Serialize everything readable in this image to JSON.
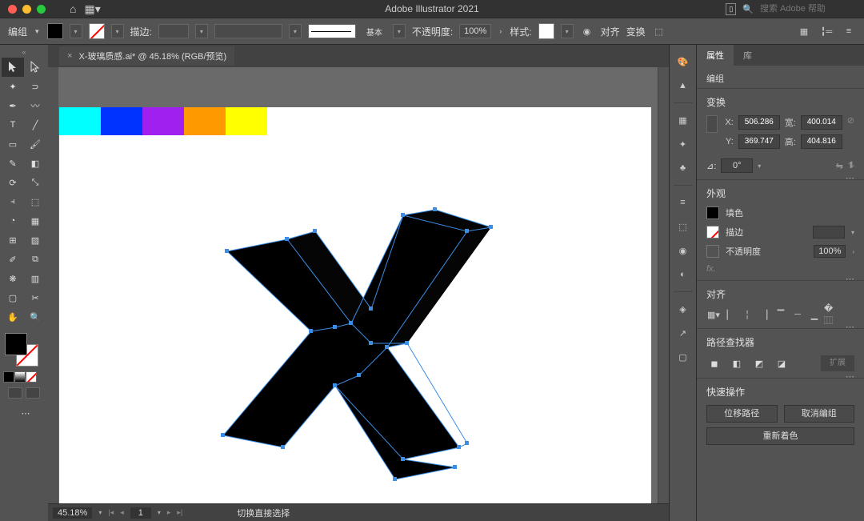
{
  "app": {
    "title": "Adobe Illustrator 2021"
  },
  "search": {
    "placeholder": "搜索 Adobe 帮助"
  },
  "control": {
    "selection_label": "编组",
    "stroke_label": "描边:",
    "brush_label": "基本",
    "opacity_label": "不透明度:",
    "opacity_value": "100%",
    "style_label": "样式:",
    "align_label": "对齐",
    "transform_label": "变换"
  },
  "document": {
    "tab_name": "X-玻璃质感.ai* @ 45.18% (RGB/预览)"
  },
  "palette_colors": [
    "#00FFFF",
    "#0033FF",
    "#A020F0",
    "#FF9900",
    "#FFFF00"
  ],
  "status": {
    "zoom": "45.18%",
    "page": "1",
    "tool_hint": "切换直接选择"
  },
  "panel": {
    "tab_props": "属性",
    "tab_lib": "库",
    "group_label": "编组",
    "transform_title": "变换",
    "x_label": "X:",
    "y_label": "Y:",
    "w_label": "宽:",
    "h_label": "高:",
    "x_val": "506.286",
    "y_val": "369.747",
    "w_val": "400.014",
    "h_val": "404.816",
    "rot_label": "⊿:",
    "rot_val": "0°",
    "appearance_title": "外观",
    "fill_label": "填色",
    "stroke_label": "描边",
    "opacity_label": "不透明度",
    "opacity_val": "100%",
    "fx_label": "fx.",
    "align_title": "对齐",
    "pathfinder_title": "路径查找器",
    "expand_label": "扩展",
    "quick_title": "快速操作",
    "offset_path": "位移路径",
    "ungroup": "取消编组",
    "recolor": "重新着色"
  }
}
